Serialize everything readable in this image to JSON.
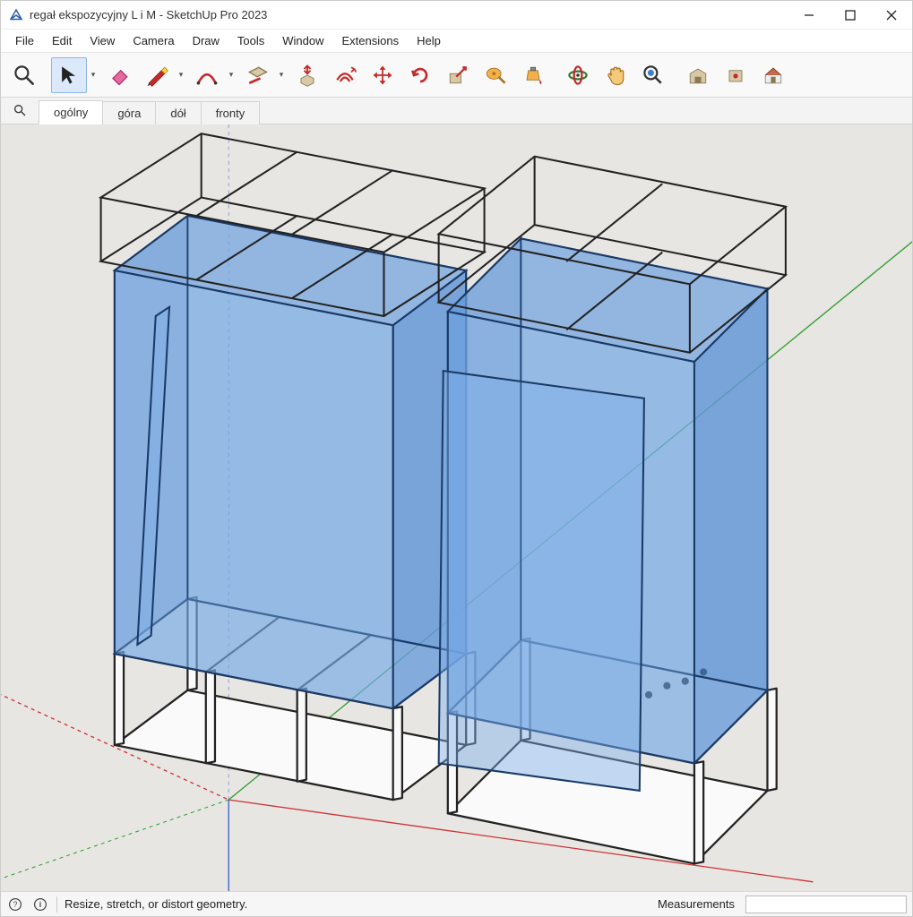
{
  "window": {
    "title": "regał ekspozycyjny L i M - SketchUp Pro 2023"
  },
  "menu": {
    "items": [
      "File",
      "Edit",
      "View",
      "Camera",
      "Draw",
      "Tools",
      "Window",
      "Extensions",
      "Help"
    ]
  },
  "toolbar": {
    "tools": [
      {
        "name": "zoom-tool",
        "icon": "magnifier"
      },
      {
        "name": "select-tool",
        "icon": "cursor",
        "selected": true,
        "dropdown": true
      },
      {
        "name": "eraser-tool",
        "icon": "eraser"
      },
      {
        "name": "line-tool",
        "icon": "pencil",
        "dropdown": true
      },
      {
        "name": "arc-tool",
        "icon": "arc",
        "dropdown": true
      },
      {
        "name": "rectangle-tool",
        "icon": "rect",
        "dropdown": true
      },
      {
        "name": "pushpull-tool",
        "icon": "pushpull"
      },
      {
        "name": "offset-tool",
        "icon": "offset"
      },
      {
        "name": "move-tool",
        "icon": "move"
      },
      {
        "name": "rotate-tool",
        "icon": "rotate"
      },
      {
        "name": "scale-tool",
        "icon": "scale"
      },
      {
        "name": "tape-tool",
        "icon": "tape"
      },
      {
        "name": "paint-tool",
        "icon": "paint"
      },
      {
        "name": "orbit-tool",
        "icon": "orbit"
      },
      {
        "name": "pan-tool",
        "icon": "pan"
      },
      {
        "name": "zoom-extents-tool",
        "icon": "zoomext"
      },
      {
        "name": "warehouse-tool",
        "icon": "warehouse"
      },
      {
        "name": "extension-tool",
        "icon": "ext"
      },
      {
        "name": "model-tool",
        "icon": "house"
      }
    ]
  },
  "scenes": {
    "tabs": [
      {
        "label": "ogólny",
        "active": true
      },
      {
        "label": "góra",
        "active": false
      },
      {
        "label": "dół",
        "active": false
      },
      {
        "label": "fronty",
        "active": false
      }
    ]
  },
  "status": {
    "hint": "Resize, stretch, or distort geometry.",
    "measurements_label": "Measurements",
    "measurements_value": ""
  },
  "icons": {
    "help": "?",
    "info": "i"
  }
}
